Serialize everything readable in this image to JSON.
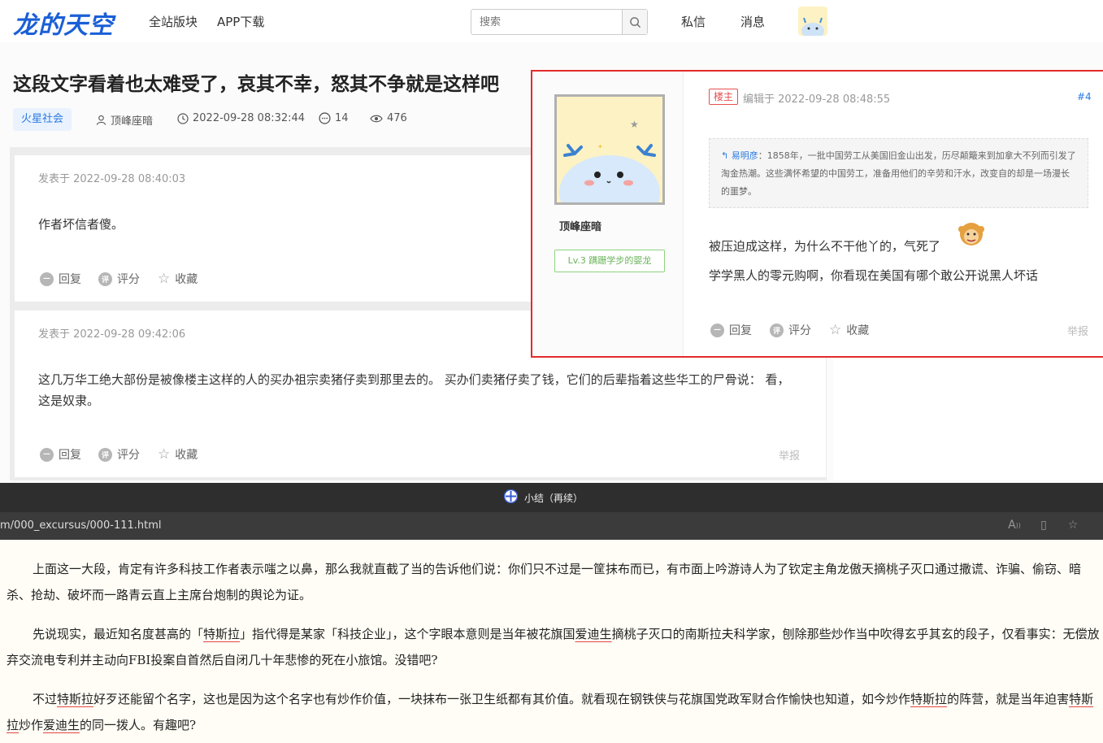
{
  "header": {
    "logo": "龙的天空",
    "nav": [
      "全站版块",
      "APP下载"
    ],
    "search_placeholder": "搜索",
    "messages": "私信",
    "notifications": "消息"
  },
  "post": {
    "title": "这段文字看着也太难受了，哀其不幸，怒其不争就是这样吧",
    "category": "火星社会",
    "author": "顶峰座暗",
    "datetime": "2022-09-28 08:32:44",
    "comments": "14",
    "views": "476"
  },
  "comments": [
    {
      "date": "发表于 2022-09-28 08:40:03",
      "text": "作者坏信者傻。",
      "actions": [
        "回复",
        "评分",
        "收藏"
      ]
    },
    {
      "date": "发表于 2022-09-28 09:42:06",
      "text": "这几万华工绝大部份是被像楼主这样的人的买办祖宗卖猪仔卖到那里去的。 买办们卖猪仔卖了钱，它们的后辈指着这些华工的尸骨说： 看，这是奴隶。",
      "actions": [
        "回复",
        "评分",
        "收藏"
      ],
      "report": "举报"
    }
  ],
  "popup": {
    "username": "顶峰座暗",
    "level": "Lv.3 蹒跚学步的婴龙",
    "owner_tag": "楼主",
    "edited": "编辑于 2022-09-28 08:48:55",
    "floor": "#4",
    "quote_name": "易明彦",
    "quote_text": "：1858年，一批中国劳工从美国旧金山出发，历尽颠簸来到加拿大不列而引发了淘金热潮。这些满怀希望的中国劳工，准备用他们的辛劳和汗水，改变自的却是一场漫长的噩梦。",
    "line1": "被压迫成这样，为什么不干他丫的，气死了",
    "line2": "学学黑人的零元购啊，你看现在美国有哪个敢公开说黑人坏话",
    "actions": [
      "回复",
      "评分",
      "收藏"
    ],
    "report": "举报"
  },
  "browser": {
    "tab_title": "小结（再续）",
    "url": "m/000_excursus/000-111.html"
  },
  "article": {
    "p1": "上面这一大段，肯定有许多科技工作者表示嗤之以鼻，那么我就直截了当的告诉他们说：你们只不过是一筐抹布而已，有市面上吟游诗人为了钦定主角龙傲天摘桃子灭口通过撒谎、诈骗、偷窃、暗杀、抢劫、破坏而一路青云直上主席台炮制的舆论为证。",
    "p2a": "先说现实，最近知名度甚高的「",
    "p2b": "特斯拉",
    "p2c": "」指代得是某家「科技企业」，这个字眼本意则是当年被花旗国",
    "p2d": "爱迪生",
    "p2e": "摘桃子灭口的南斯拉夫科学家，刨除那些炒作当中吹得玄乎其玄的段子，仅看事实：无偿放弃交流电专利并主动向FBI投案自首然后自闭几十年悲惨的死在小旅馆。没错吧?",
    "p3a": "不过",
    "p3b": "特斯拉",
    "p3c": "好歹还能留个名字，这也是因为这个名字也有炒作价值，一块抹布一张卫生纸都有其价值。就看现在钢铁侠与花旗国党政军财合作愉快也知道，如今炒作",
    "p3d": "特斯拉",
    "p3e": "的阵营，就是当年迫害",
    "p3f": "特斯拉",
    "p3g": "炒作",
    "p3h": "爱迪生",
    "p3i": "的同一拨人。有趣吧?"
  }
}
